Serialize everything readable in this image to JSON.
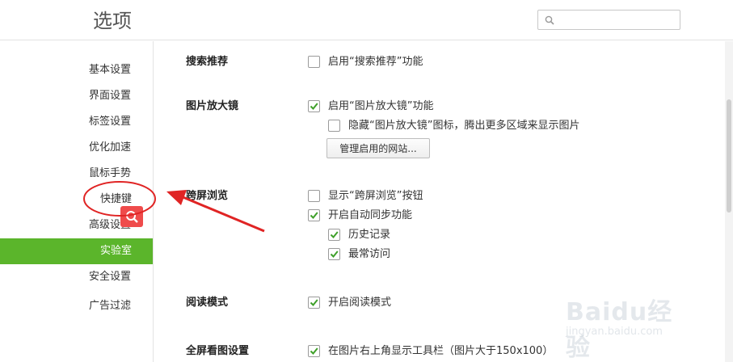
{
  "header": {
    "title": "选项",
    "search": {
      "value": "",
      "placeholder": ""
    }
  },
  "sidebar": {
    "items": [
      {
        "label": "基本设置"
      },
      {
        "label": "界面设置"
      },
      {
        "label": "标签设置"
      },
      {
        "label": "优化加速"
      },
      {
        "label": "鼠标手势"
      },
      {
        "label": "快捷键"
      },
      {
        "label": "高级设置"
      },
      {
        "label": "实验室",
        "active": true
      },
      {
        "label": "安全设置"
      },
      {
        "label": "广告过滤"
      }
    ],
    "accent_color": "#5bb52b"
  },
  "sections": {
    "search_recommend": {
      "title": "搜索推荐",
      "options": [
        {
          "label": "启用“搜索推荐”功能",
          "checked": false
        }
      ]
    },
    "image_magnifier": {
      "title": "图片放大镜",
      "options": [
        {
          "label": "启用“图片放大镜”功能",
          "checked": true
        },
        {
          "label": "隐藏“图片放大镜”图标，腾出更多区域来显示图片",
          "checked": false
        }
      ],
      "button": "管理启用的网站..."
    },
    "cross_screen": {
      "title": "跨屏浏览",
      "options": [
        {
          "label": "显示“跨屏浏览”按钮",
          "checked": false
        },
        {
          "label": "开启自动同步功能",
          "checked": true
        },
        {
          "label": "历史记录",
          "checked": true
        },
        {
          "label": "最常访问",
          "checked": true
        }
      ]
    },
    "reading_mode": {
      "title": "阅读模式",
      "options": [
        {
          "label": "开启阅读模式",
          "checked": true
        }
      ]
    },
    "fullscreen_image": {
      "title": "全屏看图设置",
      "options": [
        {
          "label": "在图片右上角显示工具栏（图片大于150x100）",
          "checked": true
        }
      ]
    }
  },
  "annotation": {
    "color": "#e02424"
  },
  "watermark": {
    "logo": "Baidu经验",
    "url": "jingyan.baidu.com"
  }
}
